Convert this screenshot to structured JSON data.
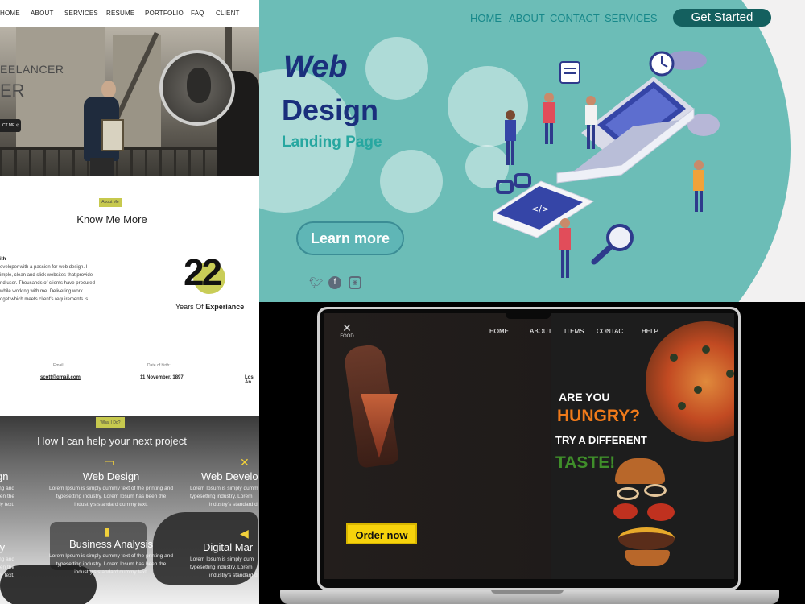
{
  "portfolio": {
    "nav": [
      "HOME",
      "ABOUT",
      "SERVICES",
      "RESUME",
      "PORTFOLIO",
      "FAQ",
      "CLIENT"
    ],
    "hero": {
      "line1": "EELANCER",
      "line2": "ER",
      "contact_button": "CT ME ⊙"
    },
    "about": {
      "tag": "About Me",
      "title": "Know Me More",
      "intro_label": "ith",
      "bio_lines": [
        "eveloper with a passion for web design. I",
        "imple, clean and slick websites that provide",
        "nd user. Thousands of clients have procured",
        "while working with me. Delivering work",
        "dget which meets client's requirements is"
      ],
      "years_number": "22",
      "years_text": "Years Of",
      "years_bold": "Experiance",
      "email_label": "Email:",
      "email_value": "scott@gmail.com",
      "dob_label": "Date of birth:",
      "dob_value": "11 November, 1897",
      "location_value": "Los An"
    },
    "services": {
      "tag": "What I Do?",
      "heading": "How I can help your next project",
      "items": [
        {
          "title": "gn",
          "desc": [
            "e printing and",
            "ry has been the",
            "ly text."
          ]
        },
        {
          "title": "Web Design",
          "desc": [
            "Lorem Ipsum is simply dummy text of the printing and",
            "typesetting industry. Lorem Ipsum has been the",
            "industry's standard dummy text."
          ]
        },
        {
          "title": "Web Develo",
          "desc": [
            "Lorem Ipsum is simply dumm",
            "typesetting industry. Lorem",
            "industry's standard d"
          ]
        },
        {
          "title": "ty",
          "desc": [
            "e printing and",
            "ry has been the",
            "ly text."
          ]
        },
        {
          "title": "Business Analysis",
          "desc": [
            "Lorem Ipsum is simply dummy text of the printing and",
            "typesetting industry. Lorem Ipsum has been the",
            "industry's standard dummy text."
          ]
        },
        {
          "title": "Digital Mar",
          "desc": [
            "Lorem Ipsum is simply dum",
            "typesetting industry. Lorem",
            "industry's standard d"
          ]
        }
      ]
    }
  },
  "webdesign": {
    "nav": [
      "HOME",
      "ABOUT",
      "CONTACT",
      "SERVICES"
    ],
    "cta": "Get Started",
    "title1": "Web",
    "title2": "Design",
    "subtitle": "Landing Page",
    "learn_more": "Learn more",
    "social_icons": [
      "twitter-icon",
      "facebook-icon",
      "instagram-icon"
    ],
    "colors": {
      "teal": "#6cbdb7",
      "navy": "#1a2f7c",
      "accent": "#27a7a0",
      "cta": "#14605f"
    }
  },
  "food": {
    "logo": "FOOD",
    "nav": [
      "HOME",
      "ABOUT",
      "ITEMS",
      "CONTACT",
      "HELP"
    ],
    "line1": "ARE YOU",
    "line2": "HUNGRY?",
    "line3": "TRY A DIFFERENT",
    "line4": "TASTE!",
    "order_button": "Order now",
    "colors": {
      "orange": "#f07a1a",
      "green": "#3f8e2a",
      "yellow": "#f6d20c"
    }
  }
}
